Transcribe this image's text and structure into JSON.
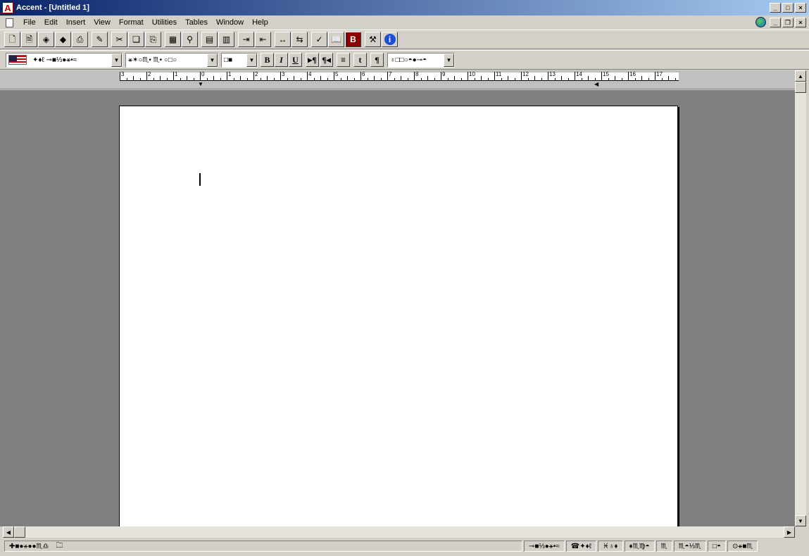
{
  "window": {
    "title": "Accent - [Untitled 1]"
  },
  "menu": [
    "File",
    "Edit",
    "Insert",
    "View",
    "Format",
    "Utilities",
    "Tables",
    "Window",
    "Help"
  ],
  "menu_mnemonics": [
    "F",
    "E",
    "I",
    "V",
    "m",
    "U",
    "T",
    "W",
    "H"
  ],
  "toolbar2": {
    "language_label": "✦♦ℓ  ⊸■⅓●⚹•≈",
    "font_label": "⚹✶○♏• ♏• ○□○",
    "size_label": "□■",
    "style_label": "♁□□○◓●⊸◓"
  },
  "status": {
    "left": "✚■●⚹●●♏♎",
    "right_items": [
      "⊸■⅓●⚹•≈",
      "☎✦♦ℓ",
      "♓♁♦",
      "♦♏♍◓",
      "♏",
      "♏◓⅓♏",
      "□◓",
      "⊙⚹■♏"
    ]
  }
}
